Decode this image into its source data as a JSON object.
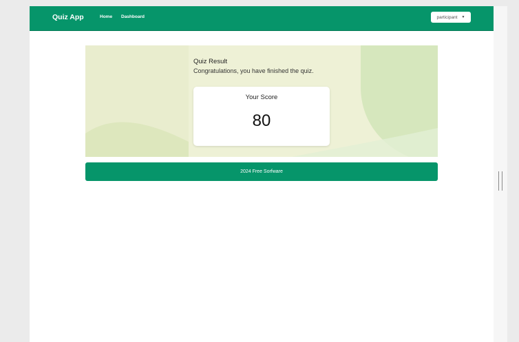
{
  "navbar": {
    "brand": "Quiz App",
    "links": [
      {
        "label": "Home"
      },
      {
        "label": "Dashboard"
      }
    ],
    "user_menu": {
      "label": "participant"
    }
  },
  "result": {
    "title": "Quiz Result",
    "subtitle": "Congratulations, you have finished the quiz."
  },
  "score": {
    "label": "Your Score",
    "value": "80"
  },
  "footer": {
    "text": "2024 Free Sorfware"
  },
  "colors": {
    "primary": "#06956a",
    "hero_background": "#eef1d6"
  }
}
